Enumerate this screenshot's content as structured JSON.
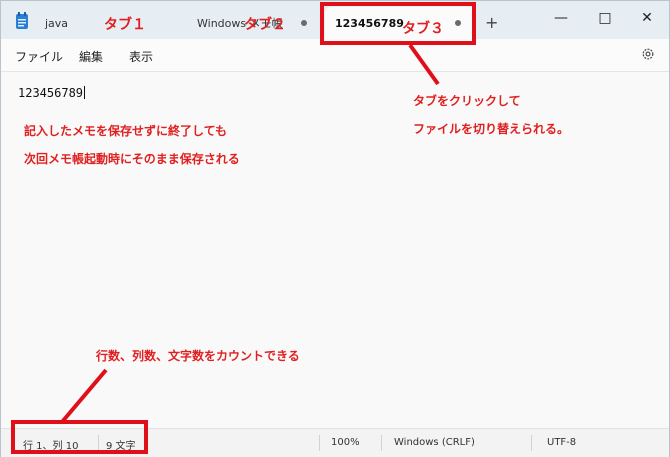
{
  "titlebar": {
    "tabs": [
      {
        "label": "java"
      },
      {
        "label": "Windows メモ帳"
      },
      {
        "label": "123456789"
      }
    ],
    "new_tab": "+",
    "minimize": "—",
    "maximize": "□",
    "close": "✕"
  },
  "menu": {
    "file": "ファイル",
    "edit": "編集",
    "view": "表示"
  },
  "editor": {
    "content": "123456789"
  },
  "status": {
    "position": "行 1、列 10",
    "char_count": "9 文字",
    "zoom": "100%",
    "line_ending": "Windows (CRLF)",
    "encoding": "UTF-8"
  },
  "annotations": {
    "tab1": "タブ１",
    "tab2": "タブ２",
    "tab3": "タブ３",
    "switch_line1": "タブをクリックして",
    "switch_line2": "ファイルを切り替えられる。",
    "save_line1": "記入したメモを保存せずに終了しても",
    "save_line2": "次回メモ帳起動時にそのまま保存される",
    "count": "行数、列数、文字数をカウントできる"
  },
  "colors": {
    "annotation": "#e02020",
    "titlebar": "#e6edf3"
  }
}
